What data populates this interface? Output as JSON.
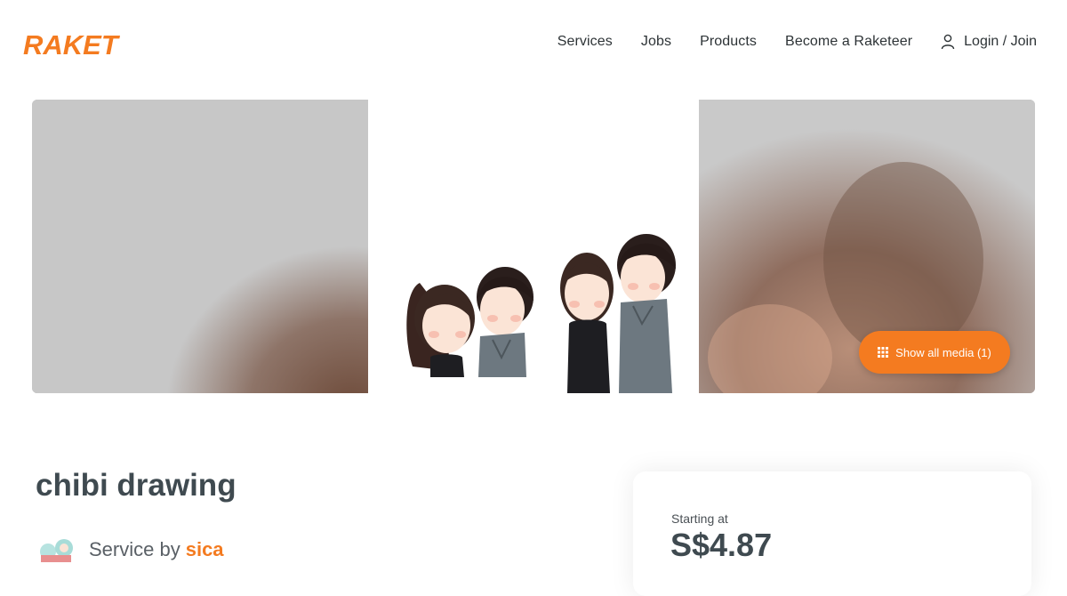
{
  "brand": {
    "logo_text": "RAKET",
    "accent": "#f47b20"
  },
  "nav": {
    "services": "Services",
    "jobs": "Jobs",
    "products": "Products",
    "become": "Become a Raketeer",
    "login": "Login / Join"
  },
  "gallery": {
    "show_all_media": "Show all media (1)"
  },
  "service": {
    "title": "chibi drawing",
    "by_label": "Service by",
    "seller": "sica"
  },
  "pricing": {
    "starting_label": "Starting at",
    "price": "S$4.87"
  }
}
